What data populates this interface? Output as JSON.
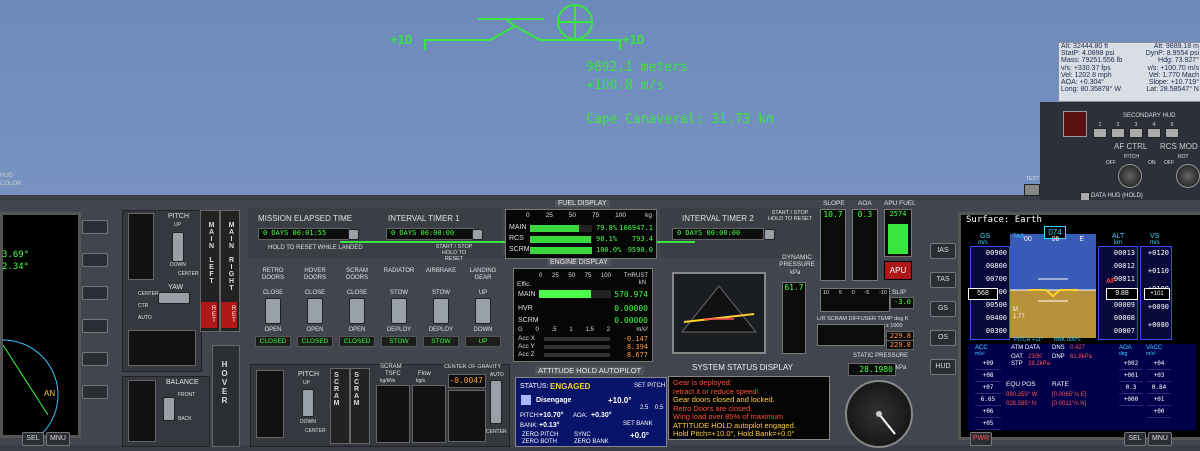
{
  "hud": {
    "pitch_left": "+10",
    "pitch_right": "+10",
    "altitude": "9892.1 meters",
    "vspeed": "+100.8 m/s",
    "target": "Cape Canaveral: 31.73 km"
  },
  "data_hud": {
    "rows": [
      [
        "Alt: 32444.80 ft",
        "Alt: 9889.18 m"
      ],
      [
        "StatP: 4.0898 psi",
        "DynP: 8.9554 psi"
      ],
      [
        "Mass: 79251.556 lb",
        "Hdg: 73.927°"
      ],
      [
        "v/s: +330.37 fps",
        "v/s: +100.70 m/s"
      ],
      [
        "Vel: 1202.8 mph",
        "Vel: 1.770 Mach"
      ],
      [
        "AOA: +0.304°",
        "Slope: +10.719°"
      ],
      [
        "Long: 80.35878° W",
        "Lat: 28.58547° N"
      ]
    ]
  },
  "secondary_hud": {
    "title": "SECONDARY HUD",
    "buttons": [
      "1",
      "2",
      "3",
      "4",
      "5"
    ]
  },
  "af_ctrl": {
    "title": "AF CTRL",
    "off": "OFF",
    "on": "ON",
    "pitch": "PITCH"
  },
  "rcs_mode": {
    "title": "RCS MOD",
    "rot": "ROT",
    "off": "OFF"
  },
  "data_hud_hold": "DATA HUD (HOLD)",
  "test_label": "TEST",
  "left_edge": {
    "hud": "HUD",
    "color": "COLOR"
  },
  "mission_timer": {
    "title": "MISSION ELAPSED TIME",
    "days": "0 DAYS",
    "time": "00:01:55",
    "hold": "HOLD TO RESET WHILE LANDED"
  },
  "interval1": {
    "title": "INTERVAL TIMER 1",
    "days": "0 DAYS",
    "time": "00:00:00",
    "hold": "START / STOP HOLD TO RESET"
  },
  "interval2": {
    "title": "INTERVAL TIMER 2",
    "days": "0 DAYS",
    "time": "00:00:00",
    "hold": "START / STOP HOLD TO RESET"
  },
  "fuel_display": {
    "title": "FUEL DISPLAY",
    "scale": [
      "0",
      "25",
      "50",
      "75",
      "100"
    ],
    "unit": "kg",
    "rows": [
      {
        "label": "MAIN",
        "pct": "79.8%",
        "kg": "106947.1",
        "fill": 0.798
      },
      {
        "label": "RCS",
        "pct": "98.1%",
        "kg": "793.4",
        "fill": 0.981
      },
      {
        "label": "SCRM",
        "pct": "100.0%",
        "kg": "9590.0",
        "fill": 1.0
      }
    ]
  },
  "engine_display": {
    "title": "ENGINE DISPLAY",
    "scale": [
      "0",
      "25",
      "50",
      "75",
      "100"
    ],
    "effic": "Effic.",
    "thrust": "THRUST",
    "kN": "kN",
    "main_label": "MAIN",
    "hvr_label": "HVR",
    "scrm_label": "SCRM",
    "main": "570.974",
    "hvr": "0.00000",
    "scrm": "0.00000",
    "main_fill": 0.72,
    "accel_scale": [
      "G",
      "0",
      ".5",
      "1",
      "1.5",
      "2"
    ],
    "accel_unit": "m/s²",
    "acc": [
      {
        "label": "Acc X",
        "value": "-0.147"
      },
      {
        "label": "Acc Y",
        "value": "8.394"
      },
      {
        "label": "Acc Z",
        "value": "8.677"
      }
    ]
  },
  "doors": {
    "items": [
      {
        "title": "RETRO DOORS",
        "top": "CLOSE",
        "bottom": "OPEN",
        "status": "CLOSED"
      },
      {
        "title": "HOVER DOORS",
        "top": "CLOSE",
        "bottom": "OPEN",
        "status": "CLOSED"
      },
      {
        "title": "SCRAM DOORS",
        "top": "CLOSE",
        "bottom": "OPEN",
        "status": "CLOSED"
      },
      {
        "title": "RADIATOR",
        "top": "STOW",
        "bottom": "DEPLOY",
        "status": "STOW"
      },
      {
        "title": "AIRBRAKE",
        "top": "STOW",
        "bottom": "DEPLOY",
        "status": "STOW"
      },
      {
        "title": "LANDING GEAR",
        "top": "UP",
        "bottom": "DOWN",
        "status": "UP"
      }
    ]
  },
  "pitch_trim": {
    "title": "PITCH",
    "up": "UP",
    "down": "DOWN",
    "center": "CENTER"
  },
  "yaw_trim": {
    "title": "YAW",
    "center": "CENTER",
    "ctr": "CTR",
    "auto": "AUTO"
  },
  "main_throttle": {
    "left": "MAIN LEFT",
    "right": "MAIN RIGHT",
    "ret": "RET"
  },
  "hover_throttle": {
    "label": "HOVER"
  },
  "balance": {
    "title": "BALANCE",
    "front": "FRONT",
    "back": "BACK"
  },
  "scram_section": {
    "title": "SCRAM",
    "pitch": "PITCH",
    "up": "UP",
    "down": "DOWN",
    "center": "CENTER",
    "scram_label": "SCRAM",
    "tsfc": "TSFC",
    "tsfc_unit": "kg/kNs",
    "flow": "Flow",
    "flow_unit": "kg/s"
  },
  "center_of_gravity": {
    "title": "CENTER OF GRAVITY",
    "value": "-0.0047",
    "auto": "AUTO",
    "center": "CENTER"
  },
  "autopilot": {
    "title": "ATTITUDE HOLD AUTOPILOT",
    "status_label": "STATUS:",
    "status": "ENGAGED",
    "set_pitch": "SET PITCH",
    "disengage": "Disengage",
    "set_value": "+10.0°",
    "steps": [
      "2.5",
      "0.5"
    ],
    "pitch_label": "PITCH:",
    "pitch": "+10.70°",
    "aoa_label": "AOA:",
    "aoa": "+0.30°",
    "bank_label": "BANK:",
    "bank": "+0.13°",
    "set_bank": "SET BANK",
    "zero_pitch": "ZERO PITCH",
    "sync": "SYNC",
    "zero_both": "ZERO BOTH",
    "zero_bank": "ZERO BANK",
    "bank_value": "+0.0°"
  },
  "system_status": {
    "title": "SYSTEM STATUS DISPLAY",
    "lines": [
      {
        "text": "Gear is deployed;",
        "color": "#ff4b3a"
      },
      {
        "text": "retract it or reduce speed!",
        "color": "#ff4b3a"
      },
      {
        "text": "Gear doors closed and locked.",
        "color": "#ffcb38"
      },
      {
        "text": "Retro Doors are closed.",
        "color": "#ff4b3a"
      },
      {
        "text": "Wing load over 85% of maximum.",
        "color": "#ff4b3a"
      },
      {
        "text": "ATTITUDE HOLD autopilot engaged.",
        "color": "#ffcb38"
      },
      {
        "text": "Hold Pitch=+10.0°, Hold Bank=+0.0°",
        "color": "#ffcb38"
      }
    ]
  },
  "dynamic_pressure": {
    "title": "DYNAMIC PRESSURE",
    "unit": "kPa",
    "value": "61.7"
  },
  "slope": {
    "title": "SLOPE",
    "value": "10.7"
  },
  "aoa_gauge": {
    "title": "AOA",
    "value": "0.3"
  },
  "apu_fuel": {
    "title": "APU FUEL",
    "value": "2574",
    "apu": "APU"
  },
  "slip": {
    "label": "SLIP",
    "value": "-3.0",
    "scale": [
      "10",
      "5",
      "0",
      "-5",
      "-10"
    ]
  },
  "diffuser": {
    "title": "L/R SCRAM DIFFUSER TEMP deg K",
    "multiplier": "x 1000",
    "values": [
      "229.8",
      "229.8"
    ]
  },
  "static_pressure": {
    "title": "STATIC PRESSURE",
    "value": "28.1980",
    "unit": "kPa"
  },
  "surface_mfd": {
    "title": "Surface: Earth",
    "gs": "GS",
    "gs_unit": "m/s",
    "tas": "TAS",
    "alt": "ALT",
    "alt_unit": "km",
    "vs": "VS",
    "vs_unit": "m/s",
    "heading": "074",
    "hdg_ticks": [
      "00",
      "06",
      "E"
    ],
    "ias_values": [
      "00900",
      "00800",
      "00700",
      "00600",
      "00500",
      "00400",
      "00300"
    ],
    "ias_readout": "568",
    "alt_values": [
      "00013",
      "00012",
      "00011",
      "00010",
      "00009",
      "00008",
      "00007"
    ],
    "alt_readout": "9.88",
    "vs_values": [
      "+0120",
      "+0110",
      "+0100",
      "+0090",
      "+0080"
    ],
    "vs_readout": "+101",
    "ap": "AP",
    "mach": "M",
    "mach_value": "1.77",
    "pitch_text": "PITCH +11°",
    "bank_text": "BNK 000°L",
    "acc": "ACC",
    "acc_unit": "m/s²",
    "atm": "ATM DATA",
    "oat": "OAT",
    "oat_value": "230K",
    "stp": "STP",
    "stp_value": "28.2kPa",
    "dns": "DNS",
    "dns_value": "0.427",
    "dnp": "DNP",
    "dnp_value": "61.8kPa",
    "aoa": "AOA",
    "aoa_unit": "deg",
    "vacc": "VACC",
    "vacc_unit": "m/s²",
    "acc_values": [
      "+09",
      "+08",
      "+07",
      "6.65",
      "+06",
      "+05"
    ],
    "aoa_values": [
      "+002",
      "+001",
      "0.3",
      "+000"
    ],
    "vacc_values": [
      "+04",
      "+03",
      "0.84",
      "+01",
      "+00"
    ],
    "equ_pos": "EQU POS",
    "rate": "RATE",
    "lon": "080.359° W",
    "lat": "028.585° N",
    "rate_lon": "[0.0065°/s E]",
    "rate_lat": "[0.0011°/s N]"
  },
  "left_mfd": {
    "v1": "3.69°",
    "v2": "2.34°",
    "marker": "AN"
  },
  "mfd_side_buttons": [
    "IAS",
    "TAS",
    "GS",
    "OS",
    "HUD"
  ],
  "bottom": {
    "sel": "SEL",
    "mnu": "MNU",
    "pwr": "PWR"
  },
  "colors": {
    "hud_green": "#39e63e",
    "warning_red": "#ff4b3a",
    "caution_yellow": "#ffcb38",
    "display_green": "#45ff45"
  }
}
